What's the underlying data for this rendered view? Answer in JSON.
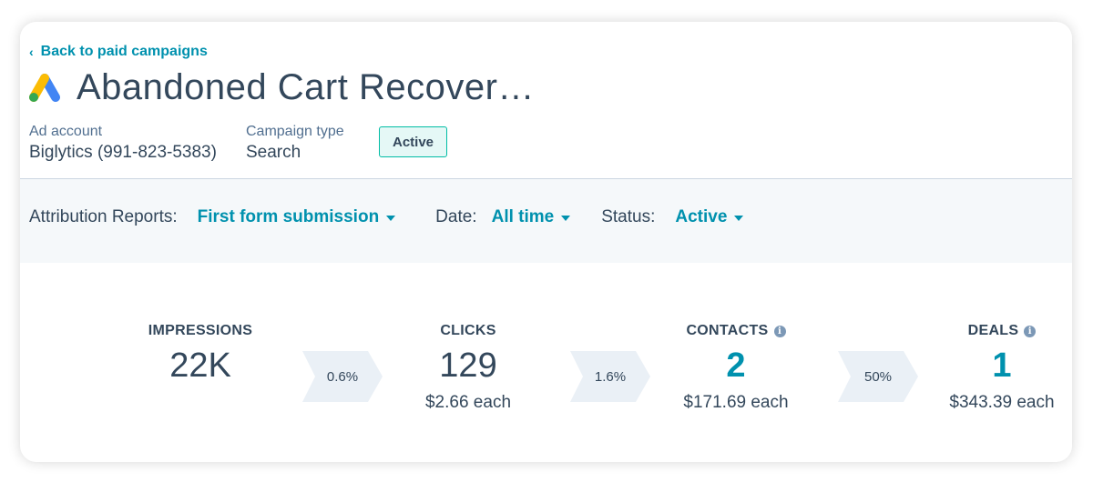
{
  "header": {
    "back_link": "Back to paid campaigns",
    "title": "Abandoned Cart Recover…",
    "ad_account_label": "Ad account",
    "ad_account_value": "Biglytics (991-823-5383)",
    "campaign_type_label": "Campaign type",
    "campaign_type_value": "Search",
    "status_badge": "Active"
  },
  "filters": {
    "attribution_label": "Attribution Reports:",
    "attribution_value": "First form submission",
    "date_label": "Date:",
    "date_value": "All time",
    "status_label": "Status:",
    "status_value": "Active"
  },
  "metrics": [
    {
      "label": "IMPRESSIONS",
      "value": "22K",
      "sub": ""
    },
    {
      "label": "CLICKS",
      "value": "129",
      "sub": "$2.66 each"
    },
    {
      "label": "CONTACTS",
      "value": "2",
      "sub": "$171.69 each"
    },
    {
      "label": "DEALS",
      "value": "1",
      "sub": "$343.39 each"
    }
  ],
  "conversions": [
    "0.6%",
    "1.6%",
    "50%"
  ],
  "colors": {
    "accent": "#0091ae",
    "text": "#33475b",
    "badge_border": "#00bda5",
    "badge_bg": "#e5f8f6",
    "filter_bg": "#f5f8fa",
    "chevron_bg": "#eaf0f6"
  },
  "icons": {
    "back": "chevron-left-icon",
    "logo": "google-ads-logo-icon",
    "info": "info-icon",
    "dropdown": "caret-down-icon"
  }
}
